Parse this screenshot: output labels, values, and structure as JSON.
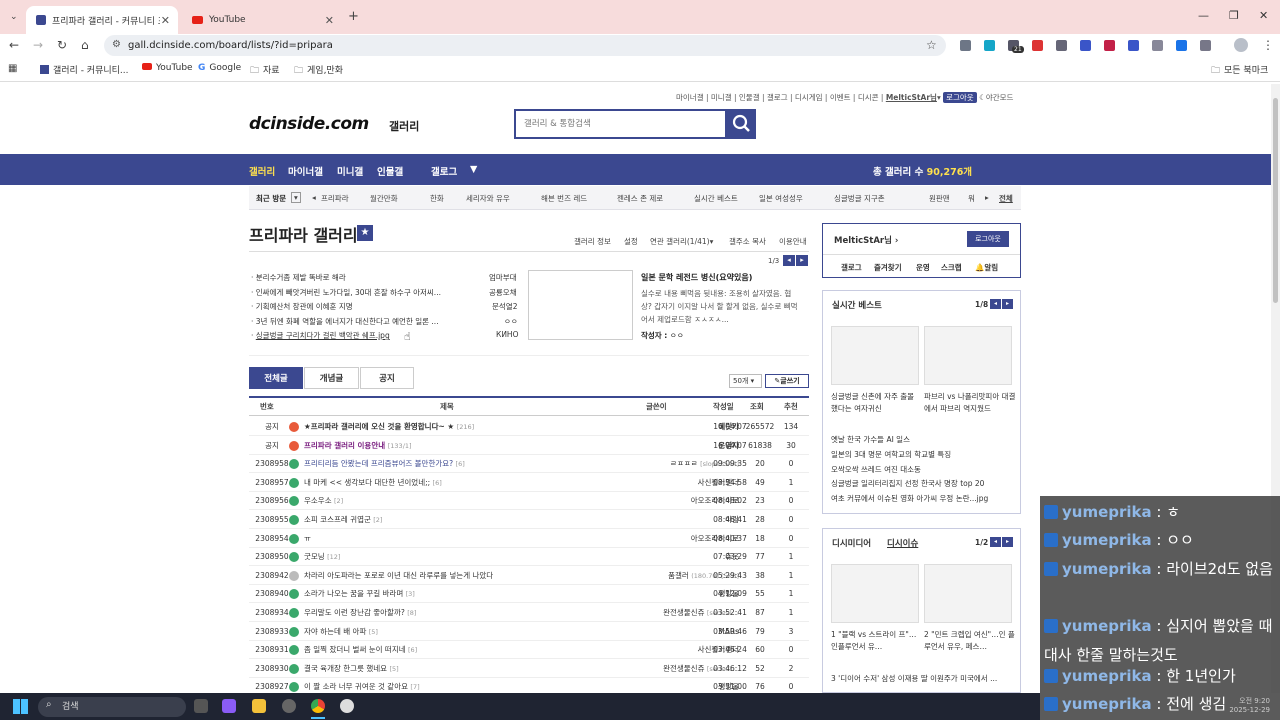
{
  "browser": {
    "tabs": [
      {
        "label": "프리파라 갤러리 - 커뮤니티 포",
        "active": true
      },
      {
        "label": "YouTube",
        "active": false
      }
    ],
    "url": "gall.dcinside.com/board/lists/?id=pripara",
    "bookmarks": [
      "갤러리 - 커뮤니티...",
      "YouTube",
      "Google",
      "자료",
      "게임,만화"
    ],
    "all_bookmarks": "모든 북마크",
    "ext_badge": "21"
  },
  "header": {
    "util": [
      "마이너갤",
      "미니갤",
      "인물갤",
      "갤로그",
      "디시게임",
      "이벤트",
      "디시콘"
    ],
    "user": "MelticStAr님",
    "logout": "로그아웃",
    "dark": "야간모드",
    "logo": "dcinside.com",
    "logo_sub": "갤러리",
    "search_placeholder": "갤러리 & 통합검색"
  },
  "gnb": {
    "items": [
      "갤러리",
      "마이너갤",
      "미니갤",
      "인물갤",
      "갤로그"
    ],
    "count_label": "총 갤러리 수",
    "count": "90,276개"
  },
  "visit": {
    "label": "최근 방문",
    "items": [
      "프리파라",
      "월간만화",
      "한화",
      "세리자와 유우",
      "해븐 번즈 레드",
      "젠레스 존 제로",
      "실시간 베스트",
      "일본 여성성우",
      "싱글벙글 지구촌",
      "원판맨",
      "워"
    ],
    "all": "전체"
  },
  "gallery": {
    "title": "프리파라 갤러리",
    "menu": [
      "갤러리 정보",
      "설정",
      "연관 갤러리(1/41)",
      "갤주소 복사",
      "이용안내"
    ],
    "page": "1/3"
  },
  "notices": [
    {
      "text": "분리수거좀 제발 똑바로 해라",
      "nick": "엄마부대"
    },
    {
      "text": "인싸에게 빼앗겨버린 노가다일, 30대 흔잘 하수구 아저씨...",
      "nick": "공룡오채"
    },
    {
      "text": "기획예산처 장관에 이혜훈 지명",
      "nick": "문석열2"
    },
    {
      "text": "3년 뒤엔 화폐 역할을 에너지가 대신한다고 예언한 일론 ...",
      "nick": "ㅇㅇ"
    },
    {
      "text": "싱글벙글 구리치다가 걸린 백악관 쉐프.jpg",
      "nick": "КИНО"
    }
  ],
  "popular": {
    "title": "일본 문학 레전드 병신(요약있음)",
    "lines": [
      "실수로 내용 삐먹음 뒷내용: 조용히 살자였음. 협",
      "상? 갑자기 이지알 나서 할 할게 없음, 실수로 삐먹",
      "어서 제업로드함 ㅈㅅㅈㅅ..."
    ],
    "author_label": "작성자 : ",
    "author": "ㅇㅇ"
  },
  "list": {
    "tabs": [
      "전체글",
      "개념글",
      "공지"
    ],
    "per_page": "50개",
    "write": "글쓰기",
    "headers": [
      "번호",
      "제목",
      "글쓴이",
      "작성일",
      "조회",
      "추천"
    ],
    "rows": [
      {
        "no": "공지",
        "title": "★프리파라 갤러리에 오신 것을 환영합니다~ ★",
        "cmt": "[216]",
        "writer": "에릿카",
        "date": "16.04.07",
        "views": "265572",
        "rec": "134",
        "type": "notice"
      },
      {
        "no": "공지",
        "title": "프리파라 갤러리 이용안내",
        "cmt": "[133/1]",
        "writer": "운영자",
        "date": "16.04.07",
        "views": "61838",
        "rec": "30",
        "type": "notice"
      },
      {
        "no": "2308958",
        "title": "프리티리듬 안봤는데 프리즘뷰어즈 볼만한가요?",
        "cmt": "[6]",
        "writer": "ㄹㅍㅍㄹ",
        "extra": "[slope3544]",
        "date": "09:09:35",
        "views": "20",
        "rec": "0",
        "type": "q"
      },
      {
        "no": "2308957",
        "title": "내 마케 << 생각보다 대단한 년이었네;;",
        "cmt": "[6]",
        "writer": "사신찡커멘더",
        "date": "08:54:58",
        "views": "49",
        "rec": "1",
        "type": "n"
      },
      {
        "no": "2308956",
        "title": "우소우소",
        "cmt": "[2]",
        "writer": "아오조라히이로",
        "date": "08:48:02",
        "views": "23",
        "rec": "0",
        "type": "n"
      },
      {
        "no": "2308955",
        "title": "소피 코스프레 귀엽군",
        "cmt": "[2]",
        "writer": "아람",
        "date": "08:46:41",
        "views": "28",
        "rec": "0",
        "type": "n"
      },
      {
        "no": "2308954",
        "title": "ㅠ",
        "cmt": "",
        "writer": "아오조라히이로",
        "date": "08:40:37",
        "views": "18",
        "rec": "0",
        "type": "n"
      },
      {
        "no": "2308950",
        "title": "굿모닝",
        "cmt": "[12]",
        "writer": "츄웃",
        "date": "07:03:29",
        "views": "77",
        "rec": "1",
        "type": "n"
      },
      {
        "no": "2308942",
        "title": "차라리 아도파라는 포로로 이년 대신 라루루를 넣는게 나았다",
        "cmt": "",
        "writer": "품갤러",
        "extra": "(180.70) [5KB]",
        "date": "05:29:43",
        "views": "38",
        "rec": "1",
        "type": "g"
      },
      {
        "no": "2308940",
        "title": "소라가 나오는 꿈을 꾸길 바라며",
        "cmt": "[3]",
        "writer": "쨍방울",
        "date": "04:12:09",
        "views": "55",
        "rec": "1",
        "type": "n"
      },
      {
        "no": "2308934",
        "title": "우리말도 이런 장난감 좋아할까?",
        "cmt": "[8]",
        "writer": "완전생물신쥬",
        "extra": "[series1...",
        "date": "03:52:41",
        "views": "87",
        "rec": "1",
        "type": "n"
      },
      {
        "no": "2308933",
        "title": "자야 하는데 배 아파",
        "cmt": "[5]",
        "writer": "MARs",
        "date": "03:50:46",
        "views": "79",
        "rec": "3",
        "type": "n"
      },
      {
        "no": "2308931",
        "title": "좀 일찍 잤더니 벌써 눈이 떠지네",
        "cmt": "[6]",
        "writer": "사신찡커멘더",
        "date": "03:46:24",
        "views": "60",
        "rec": "0",
        "type": "n"
      },
      {
        "no": "2308930",
        "title": "결국 육개장 한그릇 했네요",
        "cmt": "[5]",
        "writer": "완전생물신쥬",
        "extra": "[series1...",
        "date": "03:46:12",
        "views": "52",
        "rec": "2",
        "type": "n"
      },
      {
        "no": "2308927",
        "title": "이 짤 소라 너무 귀여운 것 같아요",
        "cmt": "[7]",
        "writer": "쨍방울",
        "date": "03:31:00",
        "views": "76",
        "rec": "0",
        "type": "n"
      }
    ]
  },
  "sidebar": {
    "user": "MelticStAr님",
    "logout": "로그아웃",
    "menu": [
      "갤로그",
      "즐겨찾기",
      "운영",
      "스크랩",
      "알림"
    ],
    "best_title": "실시간 베스트",
    "best_page": "1/8",
    "best_thumbs": [
      "싱글벙글 신촌에 자주 출몰 했다는 여자귀신",
      "파브리 vs 나폴리맛피아 대결에서 파브리 역지웠드"
    ],
    "best_list": [
      "옛날 한국 가수들 AI 일스",
      "일본의 3대 명문 여학교의 학교별 특징",
      "오싹오싹 쓰레드 여진 대소동",
      "싱글벙글 일리터리집지 선정 한국사 명장 top 20",
      "여초 커뮤에서 이슈된 영화 아가씨 우정 논란...jpg"
    ],
    "media_tabs": [
      "디시미디어",
      "디시이슈"
    ],
    "media_page": "1/2",
    "media_thumbs": [
      "1 \"블랙 vs 스트라이 프\"…인플루언서 유…",
      "2 \"민트 크렙입 여신\"…인 플루언서 유우, 페스…"
    ],
    "media_line": "3 '디이어 수저' 삼성 이재용 딸 이원주가 미국에서 ..."
  },
  "chat": [
    {
      "name": "yumeprika",
      "msg": ": ㅎ"
    },
    {
      "name": "yumeprika",
      "msg": ": ㅇㅇ"
    },
    {
      "name": "yumeprika",
      "msg": ": 라이브2d도 없음"
    },
    {
      "name": "yumeprika",
      "msg": ": 심지어 뽑았을 때 대사 한줄 말하는것도"
    },
    {
      "name": "yumeprika",
      "msg": ": 한 1년인가"
    },
    {
      "name": "yumeprika",
      "msg": ": 전에 생김"
    }
  ],
  "taskbar": {
    "search": "검색",
    "time": "오전 9:20",
    "date": "2025-12-29"
  }
}
